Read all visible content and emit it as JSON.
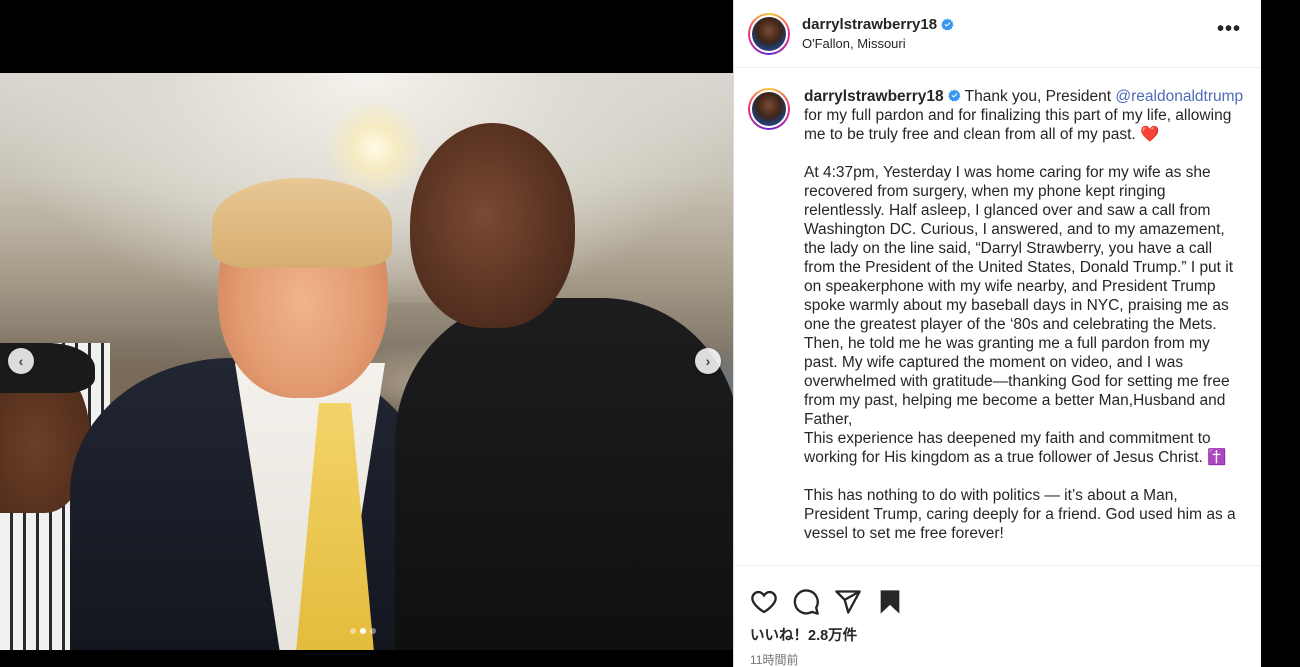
{
  "post": {
    "username": "darrylstrawberry18",
    "location": "O'Fallon, Missouri",
    "more_label": "•••"
  },
  "media": {
    "alt": "Photo of two men posing together at an event",
    "carousel": {
      "count": 3,
      "active_index": 1
    },
    "prev_label": "‹",
    "next_label": "›"
  },
  "caption": {
    "username": "darrylstrawberry18",
    "p1_before": " Thank you, President ",
    "mention": "@realdonaldtrump",
    "p1_after": " for my full pardon and for finalizing this part of my life, allowing me to be truly free and clean from all of my past. ",
    "heart": "❤️",
    "p2": "\n\nAt 4:37pm, Yesterday I was home caring for my wife as she recovered from surgery, when my phone kept ringing relentlessly. Half asleep, I glanced over and saw a call from Washington DC. Curious, I answered, and to my amazement, the lady on the line said, “Darryl Strawberry, you have a call from the President of the United States, Donald Trump.” I put it on speakerphone with my wife nearby, and President Trump spoke warmly about my baseball days in NYC, praising me as one the greatest player of the ‘80s and celebrating the Mets. Then, he told me he was granting me a full pardon from my past. My wife captured the moment on video, and I was overwhelmed with gratitude—thanking God for setting me free from my past, helping me become a better Man,Husband and Father,\nThis experience has deepened my faith and commitment to working for His kingdom as a true follower of Jesus Christ. ",
    "cross": "✝️",
    "p3": "\n\nThis has nothing to do with politics — it’s about a Man, President Trump, caring deeply for a friend. God used him as a vessel to set me free forever!\n\nI’m Free I’m Free;"
  },
  "actions": {
    "icons": [
      "heart-outline-icon",
      "comment-icon",
      "share-icon",
      "bookmark-filled-icon"
    ]
  },
  "likes_text": "いいね！2.8万件",
  "timestamp": "11時間前",
  "colors": {
    "mention": "#4e6bb8",
    "verified": "#3897f0",
    "muted": "#737373"
  }
}
